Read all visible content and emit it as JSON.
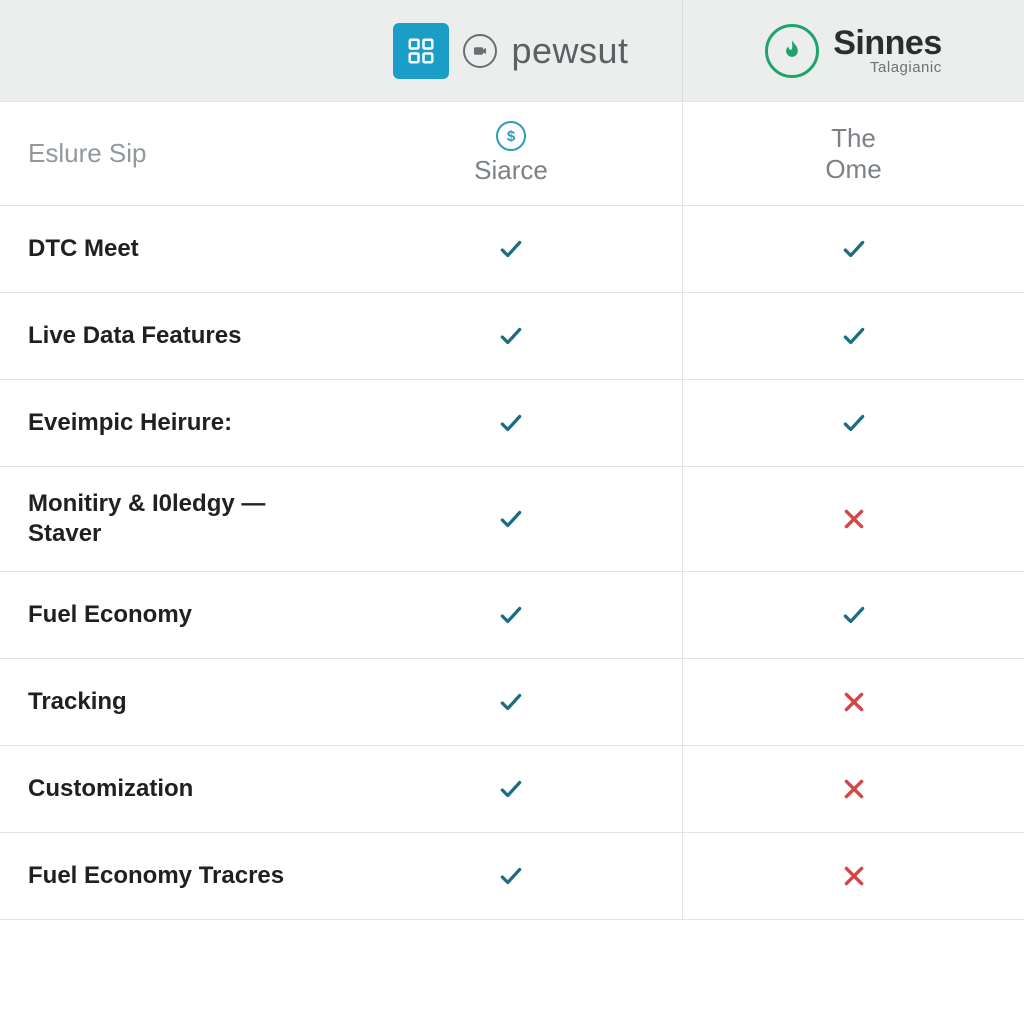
{
  "header": {
    "brand_a_wordmark": "pewsut",
    "brand_b_name": "Sinnes",
    "brand_b_sub": "Talagianic"
  },
  "subhead": {
    "row_label": "Eslure Sip",
    "col_a_label": "Siarce",
    "col_a_badge": "$",
    "col_b_label": "The\nOme"
  },
  "features": [
    {
      "label": "DTC Meet",
      "a": "check",
      "b": "check"
    },
    {
      "label": "Live Data Features",
      "a": "check",
      "b": "check"
    },
    {
      "label": "Eveimpic Heirure:",
      "a": "check",
      "b": "check"
    },
    {
      "label": "Monitiry & I0ledgy —\nStaver",
      "a": "check",
      "b": "cross"
    },
    {
      "label": "Fuel Economy",
      "a": "check",
      "b": "check"
    },
    {
      "label": "Tracking",
      "a": "check",
      "b": "cross"
    },
    {
      "label": "Customization",
      "a": "check",
      "b": "cross"
    },
    {
      "label": "Fuel Economy Tracres",
      "a": "check",
      "b": "cross"
    }
  ]
}
